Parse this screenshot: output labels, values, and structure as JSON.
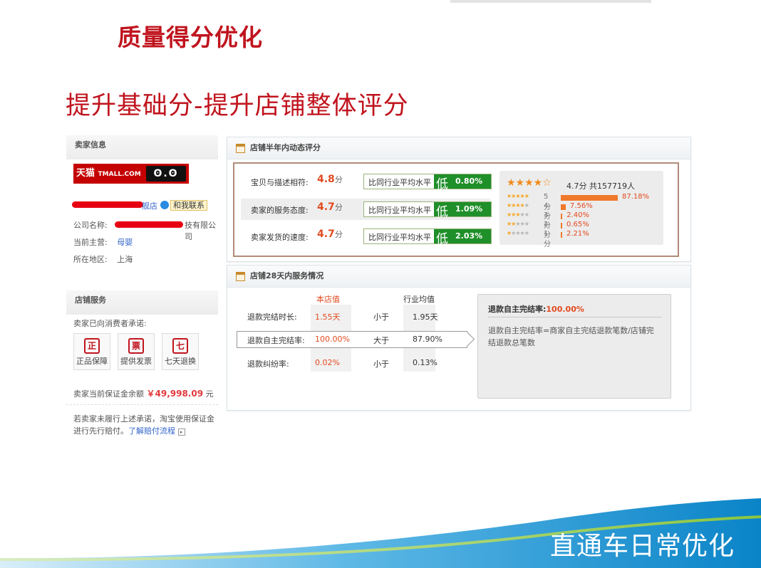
{
  "slide": {
    "title": "质量得分优化",
    "subtitle": "提升基础分-提升店铺整体评分",
    "footer": "直通车日常优化"
  },
  "seller_panel": {
    "header": "卖家信息",
    "logo_text": "天猫",
    "logo_brand": "TMALL.COM",
    "logo_cat": "ʘ.ʘ",
    "shop_suffix": "舰店",
    "contact_label": "和我联系",
    "company_label": "公司名称:",
    "company_suffix": "技有限公司",
    "main_business_label": "当前主营:",
    "main_business": "母婴",
    "location_label": "所在地区:",
    "location": "上海"
  },
  "store_service": {
    "header": "店铺服务",
    "promise": "卖家已向消费者承诺:",
    "badges": [
      {
        "icon": "正",
        "label": "正品保障"
      },
      {
        "icon": "票",
        "label": "提供发票"
      },
      {
        "icon": "七",
        "label": "七天退换"
      }
    ],
    "deposit_label": "卖家当前保证金余额",
    "deposit_value": "￥49,998.09",
    "deposit_unit": "元",
    "note_line1": "若卖家未履行上述承诺，淘宝使用保证金",
    "note_line2": "进行先行赔付。",
    "note_link": "了解赔付流程"
  },
  "dsr_panel": {
    "header": "店铺半年内动态评分",
    "compare_text": "比同行业平均水平",
    "low_text": "低",
    "score_unit": "分",
    "rows": [
      {
        "label": "宝贝与描述相符:",
        "score": "4.8",
        "pct": "0.80%"
      },
      {
        "label": "卖家的服务态度:",
        "score": "4.7",
        "pct": "1.09%"
      },
      {
        "label": "卖家发货的速度:",
        "score": "4.7",
        "pct": "2.03%"
      }
    ],
    "overall_score": "4.7分",
    "overall_total": "共157719人",
    "distribution": [
      {
        "label": "5分",
        "fraction": 0.8718,
        "pct": "87.18%"
      },
      {
        "label": "4分",
        "fraction": 0.0756,
        "pct": "7.56%"
      },
      {
        "label": "3分",
        "fraction": 0.024,
        "pct": "2.40%"
      },
      {
        "label": "2分",
        "fraction": 0.0065,
        "pct": "0.65%"
      },
      {
        "label": "1分",
        "fraction": 0.0221,
        "pct": "2.21%"
      }
    ]
  },
  "service_panel": {
    "header": "店铺28天内服务情况",
    "col_store": "本店值",
    "col_avg": "行业均值",
    "rows": [
      {
        "label": "退款完结时长:",
        "store": "1.55天",
        "cmp": "小于",
        "avg": "1.95天"
      },
      {
        "label": "退款自主完结率:",
        "store": "100.00%",
        "cmp": "大于",
        "avg": "87.90%"
      },
      {
        "label": "退款纠纷率:",
        "store": "0.02%",
        "cmp": "小于",
        "avg": "0.13%"
      }
    ],
    "info_title": "退款自主完结率:",
    "info_value": "100.00%",
    "info_desc": "退款自主完结率=商家自主完结退款笔数/店铺完结退款总笔数"
  },
  "colors": {
    "title_red": "#c0141e",
    "score_orange": "#e24a1f",
    "low_green": "#1f8f2a",
    "footer_blue": "#0a84c8"
  }
}
